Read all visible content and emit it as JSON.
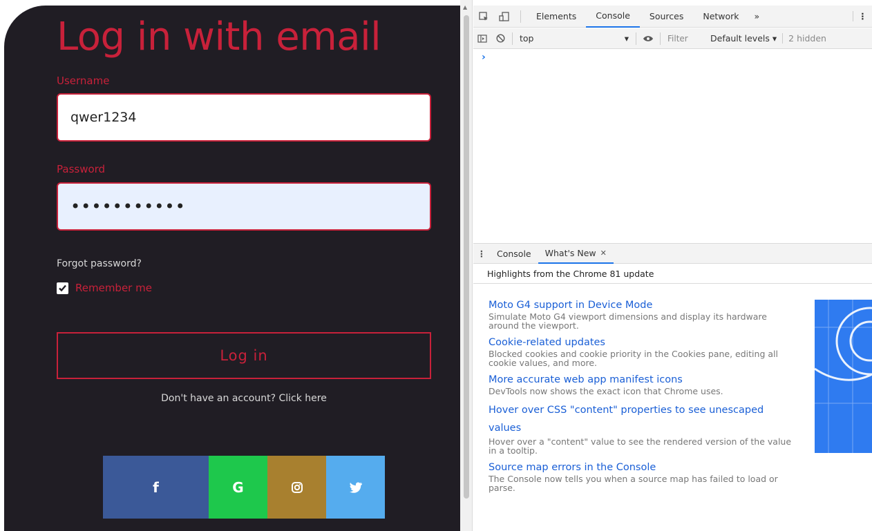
{
  "login": {
    "title": "Log in with email",
    "username_label": "Username",
    "username_value": "qwer1234",
    "password_label": "Password",
    "password_value": "•••••••••••",
    "forgot": "Forgot password?",
    "remember": "Remember me",
    "login_button": "Log in",
    "signup": "Don't have an account? Click here",
    "socials": [
      {
        "glyph": "f",
        "icon": "facebook-icon",
        "color": "#3b5998"
      },
      {
        "glyph": "G",
        "icon": "google-icon",
        "color": "#1ec84c"
      },
      {
        "glyph": "◎",
        "icon": "instagram-icon",
        "color": "#a8802f"
      },
      {
        "glyph": "🐦",
        "icon": "twitter-icon",
        "color": "#55acee"
      }
    ]
  },
  "devtools": {
    "tabs": [
      "Elements",
      "Console",
      "Sources",
      "Network"
    ],
    "active_tab": "Console",
    "more": "»",
    "context": "top",
    "filter_placeholder": "Filter",
    "levels": "Default levels ▾",
    "hidden": "2 hidden",
    "prompt": "›",
    "drawer_tabs": [
      "Console",
      "What's New"
    ],
    "drawer_close": "✕",
    "highlights": "Highlights from the Chrome 81 update",
    "news": [
      {
        "title": "Moto G4 support in Device Mode",
        "desc": "Simulate Moto G4 viewport dimensions and display its hardware around the viewport."
      },
      {
        "title": "Cookie-related updates",
        "desc": "Blocked cookies and cookie priority in the Cookies pane, editing all cookie values, and more."
      },
      {
        "title": "More accurate web app manifest icons",
        "desc": "DevTools now shows the exact icon that Chrome uses."
      },
      {
        "title": "Hover over CSS \"content\" properties to see unescaped values",
        "desc": "Hover over a \"content\" value to see the rendered version of the value in a tooltip."
      },
      {
        "title": "Source map errors in the Console",
        "desc": "The Console now tells you when a source map has failed to load or parse."
      }
    ]
  }
}
